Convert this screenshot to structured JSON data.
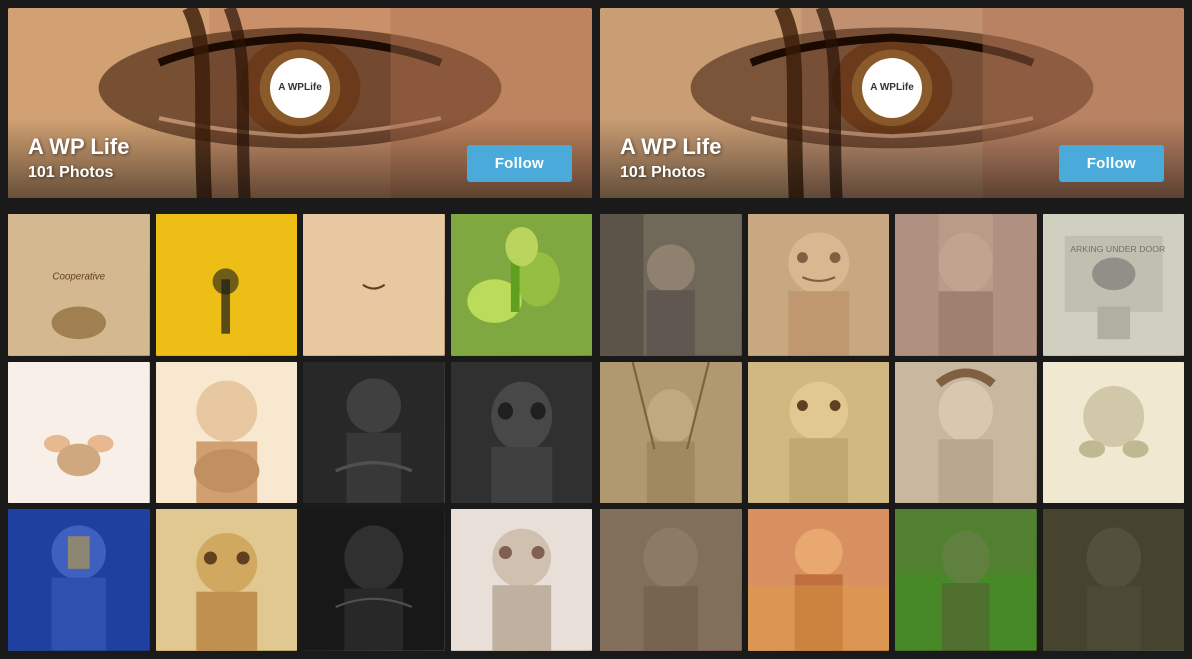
{
  "banners": [
    {
      "id": "banner-left",
      "avatar_line1": "A WP",
      "avatar_line2": "Life",
      "title": "A WP Life",
      "subtitle": "101 Photos",
      "follow_label": "Follow"
    },
    {
      "id": "banner-right",
      "avatar_line1": "A WP",
      "avatar_line2": "Life",
      "title": "A WP Life",
      "subtitle": "101 Photos",
      "follow_label": "Follow"
    }
  ],
  "left_photos": [
    {
      "id": "p1",
      "class": "p1"
    },
    {
      "id": "p2",
      "class": "p2"
    },
    {
      "id": "p3",
      "class": "p3"
    },
    {
      "id": "p4",
      "class": "p4"
    },
    {
      "id": "p5",
      "class": "p5"
    },
    {
      "id": "p6",
      "class": "p6"
    },
    {
      "id": "p7",
      "class": "p7"
    },
    {
      "id": "p8",
      "class": "p8"
    },
    {
      "id": "p9",
      "class": "p9"
    },
    {
      "id": "p10",
      "class": "p10"
    },
    {
      "id": "p11",
      "class": "p11"
    },
    {
      "id": "p12",
      "class": "p12"
    }
  ],
  "right_photos": [
    {
      "id": "q1",
      "class": "q1"
    },
    {
      "id": "q2",
      "class": "q2"
    },
    {
      "id": "q3",
      "class": "q3"
    },
    {
      "id": "q4",
      "class": "q4"
    },
    {
      "id": "q5",
      "class": "q5"
    },
    {
      "id": "q6",
      "class": "q6"
    },
    {
      "id": "q7",
      "class": "q7"
    },
    {
      "id": "q8",
      "class": "q8"
    },
    {
      "id": "q9",
      "class": "q9"
    },
    {
      "id": "q10",
      "class": "q10"
    },
    {
      "id": "q11",
      "class": "q11"
    },
    {
      "id": "q12",
      "class": "q12"
    }
  ],
  "colors": {
    "follow_bg": "#4aabdb",
    "body_bg": "#1a1a1a"
  }
}
